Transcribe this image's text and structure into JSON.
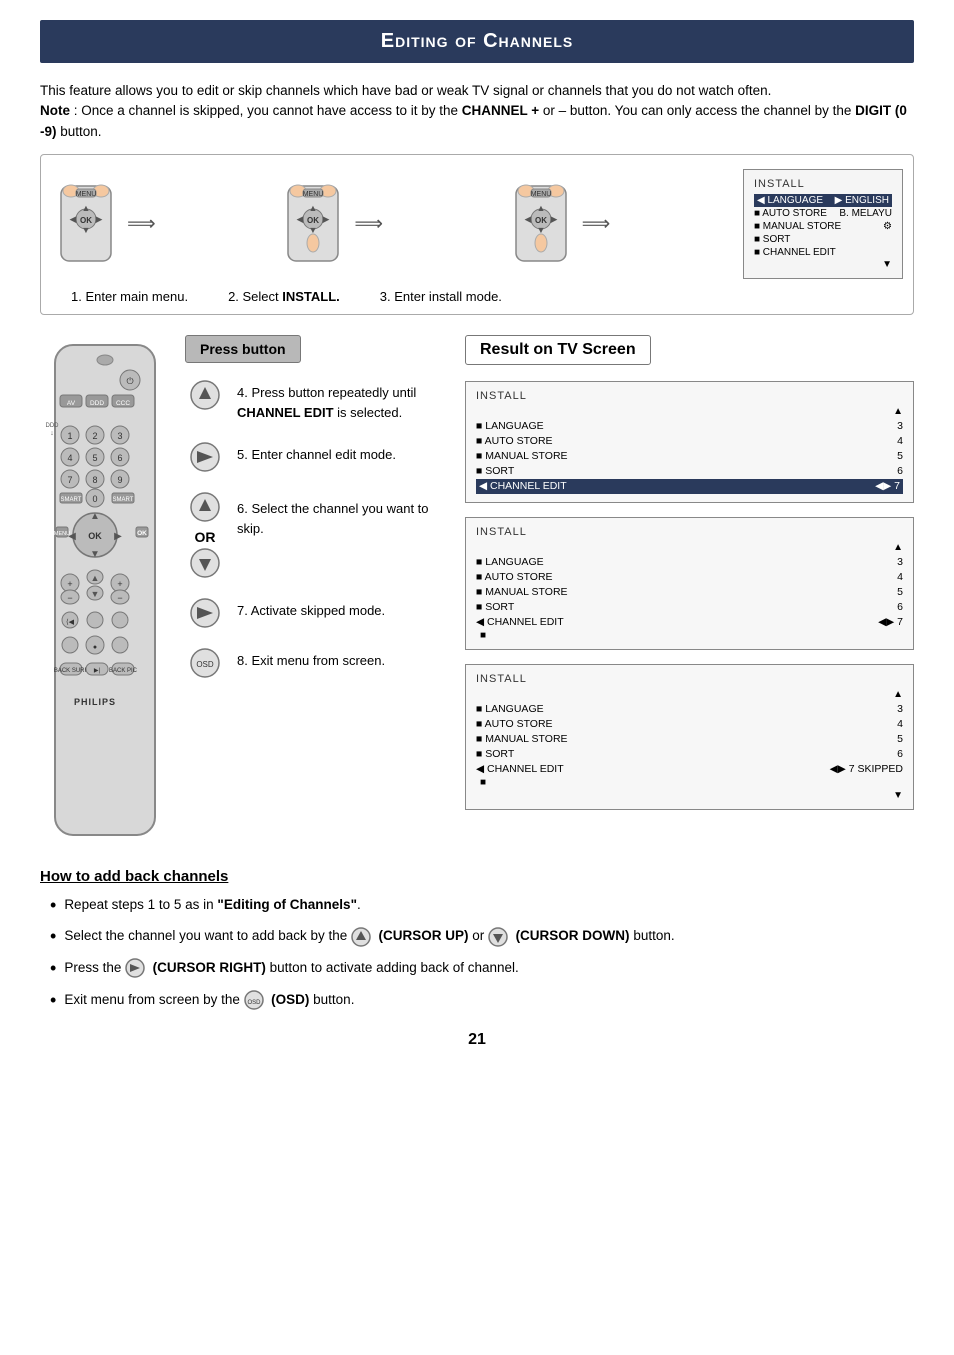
{
  "title": "Editing of Channels",
  "intro": {
    "line1": "This feature allows you to edit or skip channels which have bad or weak TV signal or channels that you do not watch often.",
    "note_label": "Note",
    "note_text": " : Once a channel is skipped, you cannot have access to it by the ",
    "channel_bold": "CHANNEL +",
    "note_mid": " or  –",
    "note_end": " button. You can only access the channel by the ",
    "digit_bold": "DIGIT (0 -9)",
    "note_final": " button."
  },
  "top_steps": {
    "step1": "1.  Enter main menu.",
    "step2": "2.  Select ",
    "step2_bold": "INSTALL.",
    "step3": "3.  Enter install mode."
  },
  "install_menu_small": {
    "title": "INSTALL",
    "items": [
      {
        "name": "LANGUAGE",
        "value": "▶ ENGLISH",
        "highlighted": true
      },
      {
        "name": "AUTO STORE",
        "value": "B. MELAYU"
      },
      {
        "name": "MANUAL STORE",
        "value": "⚙"
      },
      {
        "name": "SORT",
        "value": ""
      },
      {
        "name": "CHANNEL EDIT",
        "value": ""
      }
    ],
    "down_arrow": "▼"
  },
  "press_button_label": "Press button",
  "result_on_tv_label": "Result on TV Screen",
  "steps": [
    {
      "number": "4",
      "icon": "cursor-up-icon",
      "text": "Press button repeatedly until ",
      "text_bold": "CHANNEL EDIT",
      "text_end": " is selected.",
      "has_or": false
    },
    {
      "number": "5",
      "icon": "cursor-right-icon",
      "text": "Enter channel edit mode.",
      "has_or": false
    },
    {
      "number": "6",
      "icon": "cursor-up-icon",
      "text": "Select the channel you want to skip.",
      "has_or": true
    },
    {
      "number": "7",
      "icon": "cursor-right-icon",
      "text": "Activate skipped mode.",
      "has_or": false
    },
    {
      "number": "8",
      "icon": "osd-icon",
      "text": "Exit menu from screen.",
      "has_or": false
    }
  ],
  "tv_screens": [
    {
      "id": "screen1",
      "title": "INSTALL",
      "up_arrow": "▲",
      "items": [
        {
          "name": "LANGUAGE",
          "value": "3",
          "highlighted": false
        },
        {
          "name": "AUTO STORE",
          "value": "4",
          "highlighted": false
        },
        {
          "name": "MANUAL STORE",
          "value": "5",
          "highlighted": false
        },
        {
          "name": "SORT",
          "value": "6",
          "highlighted": false
        },
        {
          "name": "◀ CHANNEL EDIT",
          "value": "◀▶ 7",
          "highlighted": true
        }
      ],
      "down_arrow": ""
    },
    {
      "id": "screen2",
      "title": "INSTALL",
      "up_arrow": "▲",
      "items": [
        {
          "name": "LANGUAGE",
          "value": "3",
          "highlighted": false
        },
        {
          "name": "AUTO STORE",
          "value": "4",
          "highlighted": false
        },
        {
          "name": "MANUAL STORE",
          "value": "5",
          "highlighted": false
        },
        {
          "name": "SORT",
          "value": "6",
          "highlighted": false
        },
        {
          "name": "◀ CHANNEL EDIT",
          "value": "◀▶ 7",
          "highlighted": false
        }
      ],
      "extra": "■",
      "down_arrow": ""
    },
    {
      "id": "screen3",
      "title": "INSTALL",
      "up_arrow": "▲",
      "items": [
        {
          "name": "LANGUAGE",
          "value": "3",
          "highlighted": false
        },
        {
          "name": "AUTO STORE",
          "value": "4",
          "highlighted": false
        },
        {
          "name": "MANUAL STORE",
          "value": "5",
          "highlighted": false
        },
        {
          "name": "SORT",
          "value": "6",
          "highlighted": false
        },
        {
          "name": "◀ CHANNEL EDIT",
          "value": "◀▶ 7 SKIPPED",
          "highlighted": false
        }
      ],
      "extra": "■",
      "down_arrow": "▼"
    }
  ],
  "how_to": {
    "title": "How to add back channels",
    "bullets": [
      {
        "text_before": "Repeat steps 1 to 5 as in ",
        "text_bold": "\"Editing of Channels\"",
        "text_after": ".",
        "has_icon": false
      },
      {
        "text_before": "Select the channel you want to add back by the ",
        "icon1": "cursor-up",
        "text_mid": "  (CURSOR UP)  or ",
        "icon2": "cursor-down",
        "text_after": " (CURSOR DOWN) button.",
        "has_icon": true
      },
      {
        "text_before": "Press the ",
        "icon": "cursor-right",
        "text_mid": "  (CURSOR RIGHT)",
        "text_after": " button to activate adding back of channel.",
        "has_icon": true,
        "is_press": true
      },
      {
        "text_before": "Exit menu from screen by the ",
        "icon": "osd",
        "text_mid": " (OSD)",
        "text_after": " button.",
        "has_icon": true
      }
    ]
  },
  "page_number": "21"
}
